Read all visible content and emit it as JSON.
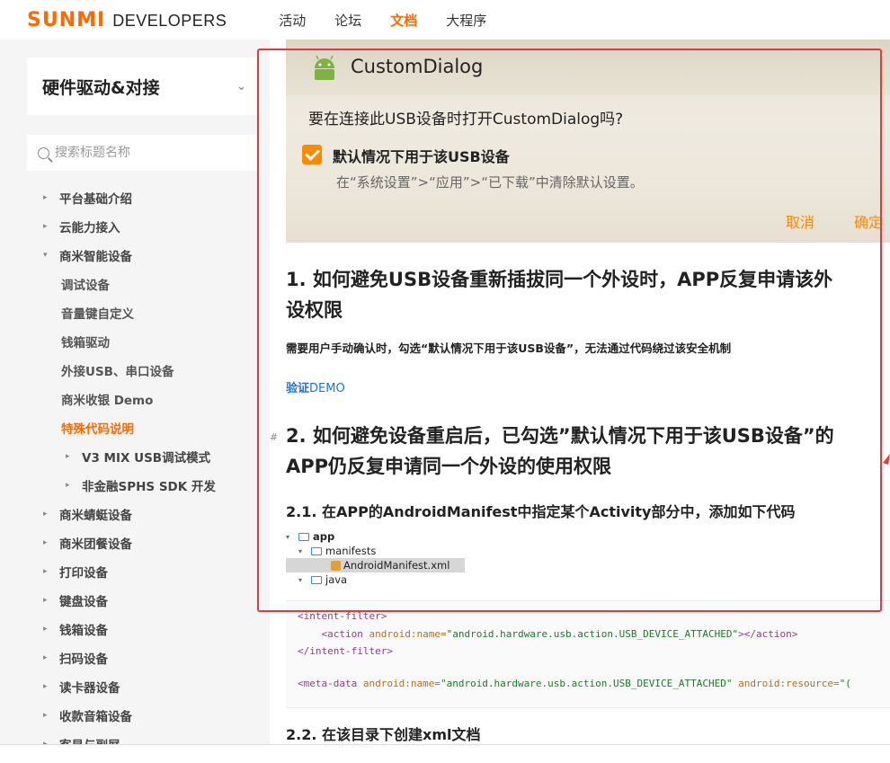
{
  "brand": {
    "logo_mark": "SUNMI",
    "logo_text": "DEVELOPERS"
  },
  "nav": [
    "活动",
    "论坛",
    "文档",
    "大程序"
  ],
  "sidebar": {
    "title": "硬件驱动&对接",
    "search_placeholder": "搜索标题名称",
    "items": [
      {
        "label": "平台基础介绍"
      },
      {
        "label": "云能力接入"
      },
      {
        "label": "商米智能设备"
      },
      {
        "label": "调试设备"
      },
      {
        "label": "音量键自定义"
      },
      {
        "label": "钱箱驱动"
      },
      {
        "label": "外接USB、串口设备"
      },
      {
        "label": "商米收银 Demo"
      },
      {
        "label": "特殊代码说明"
      },
      {
        "label": "V3 MIX USB调试模式"
      },
      {
        "label": "非金融SPHS SDK 开发"
      },
      {
        "label": "商米蜻蜓设备"
      },
      {
        "label": "商米团餐设备"
      },
      {
        "label": "打印设备"
      },
      {
        "label": "键盘设备"
      },
      {
        "label": "钱箱设备"
      },
      {
        "label": "扫码设备"
      },
      {
        "label": "读卡器设备"
      },
      {
        "label": "收款音箱设备"
      },
      {
        "label": "客显与副屏"
      }
    ]
  },
  "dialog": {
    "title": "CustomDialog",
    "question": "要在连接此USB设备时打开CustomDialog吗?",
    "checkbox_label": "默认情况下用于该USB设备",
    "hint": "在“系统设置”>“应用”>“已下载”中清除默认设置。",
    "cancel": "取消",
    "ok": "确定"
  },
  "article": {
    "h1_1_line1": "1. 如何避免USB设备重新插拔同一个外设时，APP反复申请该外",
    "h1_1_line2": "设权限",
    "p1": "需要用户手动确认时，勾选“默认情况下用于该USB设备”，无法通过代码绕过该安全机制",
    "link_prefix": "验证",
    "link_suffix": "DEMO",
    "anchor": "#",
    "h1_2_line1": "2. 如何避免设备重启后，已勾选”默认情况下用于该USB设备”的",
    "h1_2_line2": "APP仍反复申请同一个外设的使用权限",
    "h2_1": "2.1. 在APP的AndroidManifest中指定某个Activity部分中，添加如下代码",
    "h2_2": "2.2. 在该目录下创建xml文档"
  },
  "filetree": [
    "app",
    "manifests",
    "AndroidManifest.xml",
    "java"
  ],
  "code": {
    "l1": "<intent-filter>",
    "l2_tag_open": "<action ",
    "l2_attr": "android:name=",
    "l2_str": "\"android.hardware.usb.action.USB_DEVICE_ATTACHED\"",
    "l2_tag_close": "></action>",
    "l3": "</intent-filter>",
    "l5_tag_open": "<meta-data ",
    "l5_attr1": "android:name=",
    "l5_str": "\"android.hardware.usb.action.USB_DEVICE_ATTACHED\"",
    "l5_attr2": " android:resource=",
    "l5_rest": "\"("
  }
}
